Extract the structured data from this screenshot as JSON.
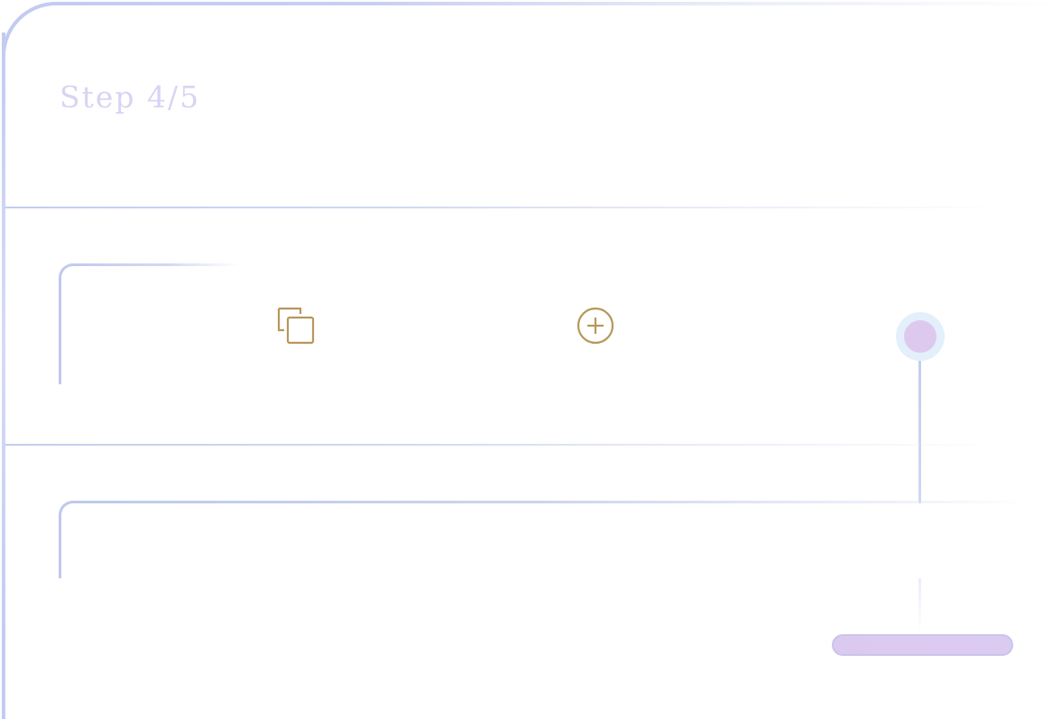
{
  "wizard": {
    "step_label": "Step 4/5"
  },
  "icons": {
    "copy": "copy-icon",
    "add": "add-circle-icon"
  },
  "colors": {
    "accent_border": "#c2cbf1",
    "title_text": "#d9d4f3",
    "icon_gold": "#b8975b",
    "knob_fill": "#ddc9ee",
    "knob_halo": "#e3f0fb",
    "pill_fill": "#dcc9ef"
  }
}
